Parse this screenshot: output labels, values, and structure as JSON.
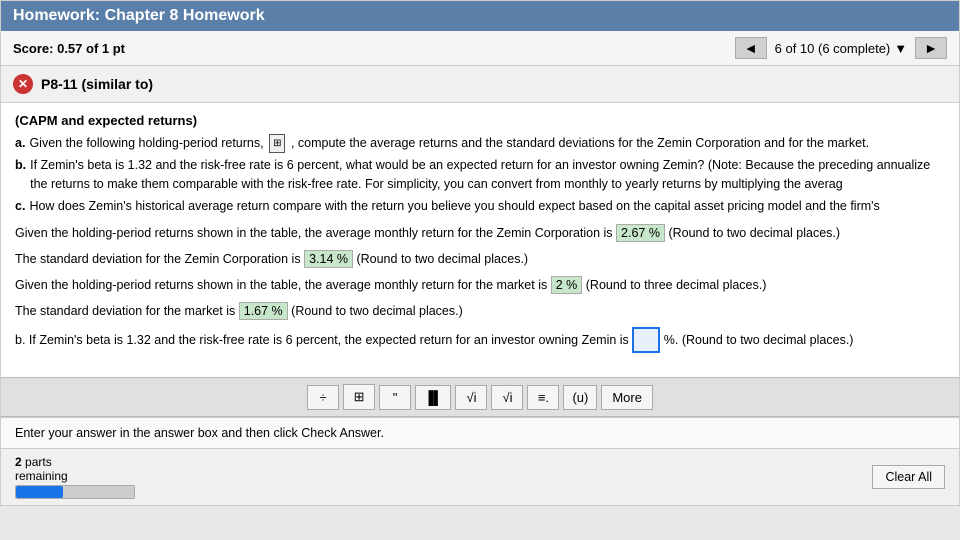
{
  "header": {
    "title": "Homework: Chapter 8 Homework"
  },
  "score": {
    "label": "Score:",
    "value": "0.57 of 1 pt"
  },
  "navigation": {
    "prev_label": "◄",
    "next_label": "►",
    "status": "6 of 10 (6 complete)",
    "dropdown_arrow": "▼"
  },
  "problem": {
    "icon": "✕",
    "title": "P8-11 (similar to)"
  },
  "capm": {
    "section_title": "(CAPM and expected returns)"
  },
  "instructions": {
    "a_label": "a.",
    "a_text": "Given the following holding-period returns,",
    "a_text2": ", compute the average returns and the standard deviations for the Zemin Corporation and for the market.",
    "b_label": "b.",
    "b_text": "If Zemin's beta is 1.32 and the risk-free rate is 6 percent, what would be an expected return for an investor owning Zemin?  (Note: Because the preceding annualize the returns to make them comparable with the risk-free rate.  For simplicity, you can convert from monthly to yearly returns by multiplying the averag",
    "c_label": "c.",
    "c_text": "How does Zemin's historical average return compare with the return you believe you should expect based on the capital asset pricing model and the firm's"
  },
  "answers": {
    "a1_prefix": "Given the holding-period returns shown in the table, the average monthly return for the Zemin Corporation is",
    "a1_value": "2.67 %",
    "a1_suffix": "(Round to two decimal places.)",
    "a2_prefix": "The standard deviation for the Zemin Corporation is",
    "a2_value": "3.14 %",
    "a2_suffix": "(Round to two decimal places.)",
    "a3_prefix": "Given the holding-period returns shown in the table, the average monthly return for the market is",
    "a3_value": "2 %",
    "a3_suffix": "(Round to three decimal places.)",
    "a4_prefix": "The standard deviation for the market is",
    "a4_value": "1.67 %",
    "a4_suffix": "(Round to two decimal places.)",
    "b_prefix": "b.  If Zemin's beta is 1.32 and the risk-free rate is 6 percent, the expected return for an investor owning Zemin is",
    "b_input": "",
    "b_suffix": "%.  (Round to two decimal places.)"
  },
  "toolbar": {
    "btn1": "÷",
    "btn2": "⊞",
    "btn3": "\"",
    "btn4": "▐▌",
    "btn5": "√i",
    "btn6": "√i",
    "btn7": "≡.",
    "btn8": "(u)",
    "more_label": "More"
  },
  "enter_answer": {
    "text": "Enter your answer in the answer box and then click Check Answer."
  },
  "bottom": {
    "parts_label": "2",
    "parts_sub": "parts",
    "parts_sub2": "remaining",
    "progress_pct": 40,
    "clear_all_label": "Clear All"
  }
}
